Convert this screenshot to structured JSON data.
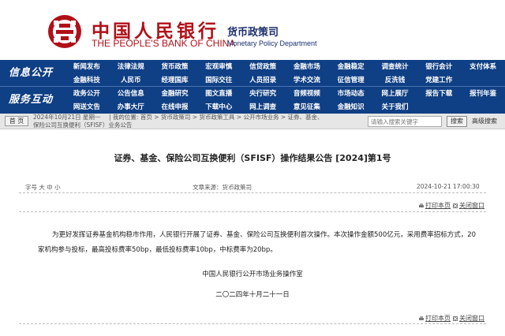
{
  "header": {
    "bank_cn": "中国人民银行",
    "bank_en": "THE PEOPLE'S BANK OF CHINA",
    "dept_cn": "货币政策司",
    "dept_en": "Monetary Policy Department"
  },
  "nav": {
    "section1": "信息公开",
    "section2": "服务互动",
    "row1": [
      "新闻发布",
      "法律法规",
      "货币政策",
      "宏观审慎",
      "信贷政策",
      "金融市场",
      "金融稳定",
      "调查统计",
      "银行会计",
      "支付体系"
    ],
    "row2": [
      "金融科技",
      "人民币",
      "经理国库",
      "国际交往",
      "人员招录",
      "学术交流",
      "征信管理",
      "反洗钱",
      "党建工作",
      ""
    ],
    "row3": [
      "政务公开",
      "公告信息",
      "金融研究",
      "图文直播",
      "央行研究",
      "音频视频",
      "市场动态",
      "网上展厅",
      "报告下载",
      "报刊年鉴"
    ],
    "row4": [
      "网送文告",
      "办事大厅",
      "在线申报",
      "下载中心",
      "网上调查",
      "意见征集",
      "金融知识",
      "关于我们",
      "",
      ""
    ]
  },
  "breadcrumb": {
    "home": "首 页",
    "date": "2024年10月21日 星期一",
    "location": "| 我的位置: 首页 > 货币政策司 > 货币政策工具 > 公开市场业务 > 证券、基金、",
    "location2": "保险公司互换便利（SFISF）业务公告",
    "search_placeholder": "请输入搜索关键字",
    "search_button": "搜索",
    "advanced_search": "高级搜索"
  },
  "article": {
    "title": "证券、基金、保险公司互换便利（SFISF）操作结果公告 [2024]第1号",
    "font_size_label": "字号 大 中 小",
    "source": "文章来源：货币政策司",
    "time": "2024-10-21  17:00:30",
    "print": "打印本页",
    "close": "关闭窗口",
    "body": "为更好发挥证券基金机构稳市作用，人民银行开展了证券、基金、保险公司互换便利首次操作。本次操作金额500亿元，采用费率招标方式，20家机构参与投标，最高投标费率50bp，最低投标费率10bp，中标费率为20bp。",
    "signer": "中国人民银行公开市场业务操作室",
    "date": "二〇二四年十月二十一日"
  },
  "colors": {
    "nav_bg": "#0f3f84",
    "brand_red": "#b01018",
    "dept_blue": "#1d2f6e"
  }
}
